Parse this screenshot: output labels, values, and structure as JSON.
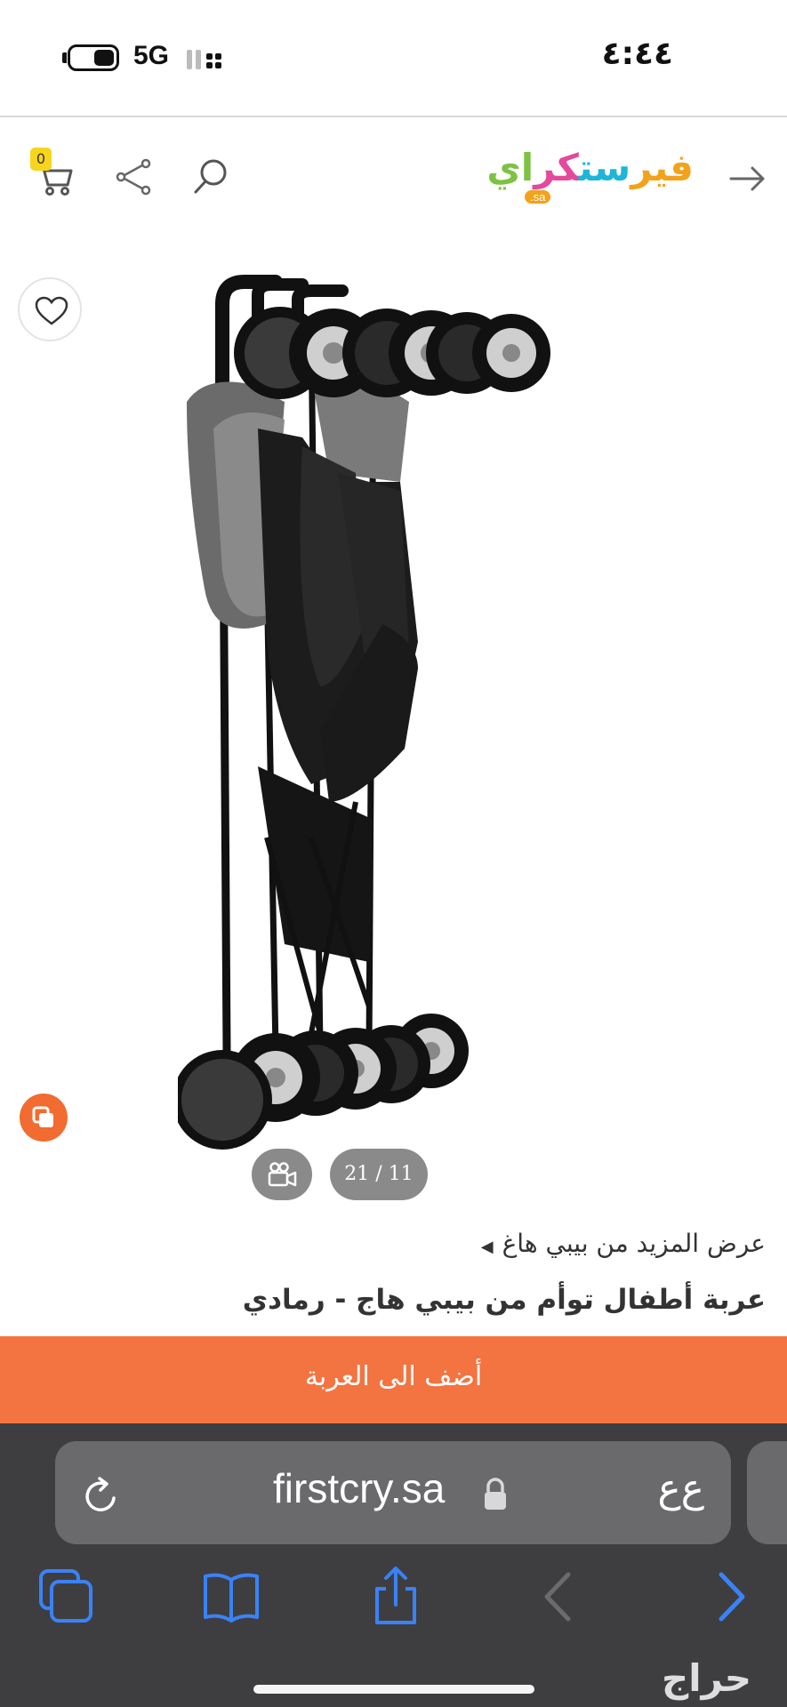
{
  "status_bar": {
    "network": "5G",
    "time": "٤:٤٤"
  },
  "header": {
    "cart_count": "0",
    "logo_text": "فيرستكراي",
    "logo_domain": ".sa",
    "icons": [
      "back-arrow-icon",
      "search-icon",
      "share-icon",
      "cart-icon"
    ]
  },
  "gallery": {
    "image_counter": "21 / 11",
    "icons": [
      "heart-icon",
      "compare-icon",
      "video-icon"
    ]
  },
  "product": {
    "more_from_brand": "عرض المزيد من بيبي هاغ",
    "title": "عربة أطفال توأم من بيبي هاج - رمادي",
    "add_to_cart": "أضف الى العربة"
  },
  "browser": {
    "url": "firstcry.sa",
    "text_size_label": "ﻉﻉ",
    "watermark": "حراج",
    "toolbar_icons": [
      "tabs-icon",
      "bookmarks-icon",
      "share-icon",
      "back-icon",
      "forward-icon"
    ]
  },
  "colors": {
    "accent": "#f37440",
    "browser_bar": "#3e3e40",
    "ios_blue": "#3a82f7"
  }
}
